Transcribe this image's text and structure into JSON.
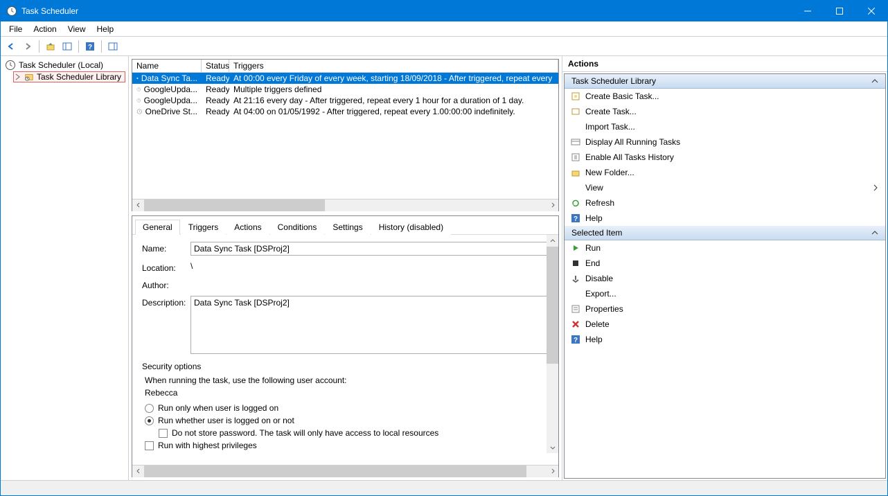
{
  "window": {
    "title": "Task Scheduler"
  },
  "menu": {
    "file": "File",
    "action": "Action",
    "view": "View",
    "help": "Help"
  },
  "tree": {
    "root": "Task Scheduler (Local)",
    "library": "Task Scheduler Library"
  },
  "tasklist": {
    "headers": {
      "name": "Name",
      "status": "Status",
      "triggers": "Triggers"
    },
    "rows": [
      {
        "name": "Data Sync Ta...",
        "status": "Ready",
        "trigger": "At 00:00 every Friday of every week, starting 18/09/2018 - After triggered, repeat every"
      },
      {
        "name": "GoogleUpda...",
        "status": "Ready",
        "trigger": "Multiple triggers defined"
      },
      {
        "name": "GoogleUpda...",
        "status": "Ready",
        "trigger": "At 21:16 every day - After triggered, repeat every 1 hour for a duration of 1 day."
      },
      {
        "name": "OneDrive St...",
        "status": "Ready",
        "trigger": "At 04:00 on 01/05/1992 - After triggered, repeat every 1.00:00:00 indefinitely."
      }
    ]
  },
  "tabs": {
    "general": "General",
    "triggers": "Triggers",
    "actions": "Actions",
    "conditions": "Conditions",
    "settings": "Settings",
    "history": "History (disabled)"
  },
  "general": {
    "name_label": "Name:",
    "name_value": "Data Sync Task [DSProj2]",
    "location_label": "Location:",
    "location_value": "\\",
    "author_label": "Author:",
    "author_value": "",
    "description_label": "Description:",
    "description_value": "Data Sync Task [DSProj2]",
    "security_title": "Security options",
    "security_text": "When running the task, use the following user account:",
    "security_user": "Rebecca",
    "radio_logged_on": "Run only when user is logged on",
    "radio_logged_off": "Run whether user is logged on or not",
    "check_no_password": "Do not store password.  The task will only have access to local resources",
    "check_highest": "Run with highest privileges"
  },
  "actions": {
    "title": "Actions",
    "section_library": "Task Scheduler Library",
    "section_selected": "Selected Item",
    "library_items": [
      "Create Basic Task...",
      "Create Task...",
      "Import Task...",
      "Display All Running Tasks",
      "Enable All Tasks History",
      "New Folder...",
      "View",
      "Refresh",
      "Help"
    ],
    "selected_items": [
      "Run",
      "End",
      "Disable",
      "Export...",
      "Properties",
      "Delete",
      "Help"
    ]
  }
}
